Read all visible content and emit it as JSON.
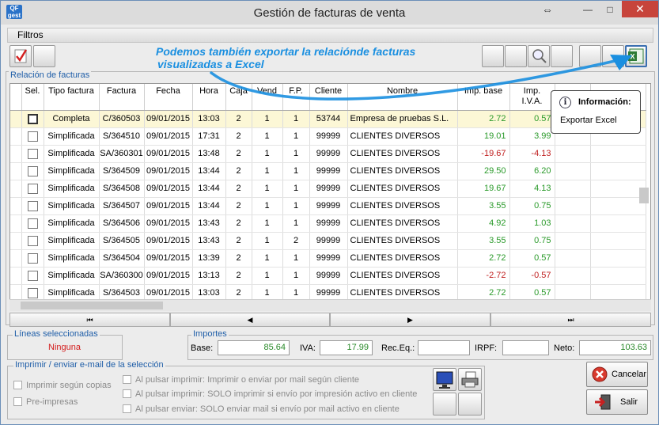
{
  "window": {
    "title": "Gestión de facturas de venta",
    "app_icon_text": "QF\ngest",
    "restore_glyph": "⇔",
    "min_glyph": "—",
    "max_glyph": "□",
    "close_glyph": "✕"
  },
  "filters_bar": {
    "label": "Filtros"
  },
  "callout": {
    "line1": "Podemos también exportar la relaciónde facturas",
    "line2": "visualizadas a Excel"
  },
  "grid_group": {
    "label": "Relación de facturas"
  },
  "grid": {
    "columns": [
      {
        "label": "Sel."
      },
      {
        "label": "Tipo factura"
      },
      {
        "label": "Factura"
      },
      {
        "label": "Fecha"
      },
      {
        "label": "Hora"
      },
      {
        "label": "Caja"
      },
      {
        "label": "Vend"
      },
      {
        "label": "F.P."
      },
      {
        "label": "Cliente"
      },
      {
        "label": "Nombre"
      },
      {
        "label": "Imp. base"
      },
      {
        "label": "Imp. I.V.A."
      },
      {
        "label": ""
      },
      {
        "label": ""
      }
    ],
    "rows": [
      {
        "tipo": "Completa",
        "factura": "C/360503",
        "fecha": "09/01/2015",
        "hora": "13:03",
        "caja": "2",
        "vend": "1",
        "fp": "1",
        "cliente": "53744",
        "nombre": "Empresa de pruebas S.L.",
        "base": "2.72",
        "iva": "0.57",
        "selected": true
      },
      {
        "tipo": "Simplificada",
        "factura": "S/364510",
        "fecha": "09/01/2015",
        "hora": "17:31",
        "caja": "2",
        "vend": "1",
        "fp": "1",
        "cliente": "99999",
        "nombre": "CLIENTES DIVERSOS",
        "base": "19.01",
        "iva": "3.99",
        "selected": false
      },
      {
        "tipo": "Simplificada",
        "factura": "SA/360301",
        "fecha": "09/01/2015",
        "hora": "13:48",
        "caja": "2",
        "vend": "1",
        "fp": "1",
        "cliente": "99999",
        "nombre": "CLIENTES DIVERSOS",
        "base": "-19.67",
        "iva": "-4.13",
        "selected": false
      },
      {
        "tipo": "Simplificada",
        "factura": "S/364509",
        "fecha": "09/01/2015",
        "hora": "13:44",
        "caja": "2",
        "vend": "1",
        "fp": "1",
        "cliente": "99999",
        "nombre": "CLIENTES DIVERSOS",
        "base": "29.50",
        "iva": "6.20",
        "selected": false
      },
      {
        "tipo": "Simplificada",
        "factura": "S/364508",
        "fecha": "09/01/2015",
        "hora": "13:44",
        "caja": "2",
        "vend": "1",
        "fp": "1",
        "cliente": "99999",
        "nombre": "CLIENTES DIVERSOS",
        "base": "19.67",
        "iva": "4.13",
        "selected": false
      },
      {
        "tipo": "Simplificada",
        "factura": "S/364507",
        "fecha": "09/01/2015",
        "hora": "13:44",
        "caja": "2",
        "vend": "1",
        "fp": "1",
        "cliente": "99999",
        "nombre": "CLIENTES DIVERSOS",
        "base": "3.55",
        "iva": "0.75",
        "selected": false
      },
      {
        "tipo": "Simplificada",
        "factura": "S/364506",
        "fecha": "09/01/2015",
        "hora": "13:43",
        "caja": "2",
        "vend": "1",
        "fp": "1",
        "cliente": "99999",
        "nombre": "CLIENTES DIVERSOS",
        "base": "4.92",
        "iva": "1.03",
        "selected": false
      },
      {
        "tipo": "Simplificada",
        "factura": "S/364505",
        "fecha": "09/01/2015",
        "hora": "13:43",
        "caja": "2",
        "vend": "1",
        "fp": "2",
        "cliente": "99999",
        "nombre": "CLIENTES DIVERSOS",
        "base": "3.55",
        "iva": "0.75",
        "selected": false
      },
      {
        "tipo": "Simplificada",
        "factura": "S/364504",
        "fecha": "09/01/2015",
        "hora": "13:39",
        "caja": "2",
        "vend": "1",
        "fp": "1",
        "cliente": "99999",
        "nombre": "CLIENTES DIVERSOS",
        "base": "2.72",
        "iva": "0.57",
        "selected": false
      },
      {
        "tipo": "Simplificada",
        "factura": "SA/360300",
        "fecha": "09/01/2015",
        "hora": "13:13",
        "caja": "2",
        "vend": "1",
        "fp": "1",
        "cliente": "99999",
        "nombre": "CLIENTES DIVERSOS",
        "base": "-2.72",
        "iva": "-0.57",
        "selected": false
      },
      {
        "tipo": "Simplificada",
        "factura": "S/364503",
        "fecha": "09/01/2015",
        "hora": "13:03",
        "caja": "2",
        "vend": "1",
        "fp": "1",
        "cliente": "99999",
        "nombre": "CLIENTES DIVERSOS",
        "base": "2.72",
        "iva": "0.57",
        "selected": false
      }
    ]
  },
  "nav": {
    "first": "⏮",
    "prev": "◀",
    "next": "▶",
    "last": "⏭"
  },
  "tooltip": {
    "icon": "i",
    "title": "Información:",
    "text": "Exportar Excel"
  },
  "selected_lines": {
    "label": "Líneas seleccionadas",
    "value": "Ninguna"
  },
  "totals": {
    "label": "Importes",
    "base_label": "Base:",
    "base": "85.64",
    "iva_label": "IVA:",
    "iva": "17.99",
    "receq_label": "Rec.Eq.:",
    "receq": "",
    "irpf_label": "IRPF:",
    "irpf": "",
    "neto_label": "Neto:",
    "neto": "103.63"
  },
  "print": {
    "label": "Imprimir / enviar e-mail de la selección",
    "opt_copies": "Imprimir según copias",
    "opt_preprinted": "Pre-impresas",
    "opt_mail_client": "Al pulsar imprimir: Imprimir o enviar por mail según cliente",
    "opt_only_print": "Al pulsar imprimir: SOLO imprimir si envío por impresión activo en cliente",
    "opt_only_mail": "Al pulsar enviar: SOLO enviar mail si envío por mail activo en cliente"
  },
  "buttons": {
    "cancel": "Cancelar",
    "exit": "Salir"
  },
  "colors": {
    "positive": "#2a9a2a",
    "negative": "#c02020",
    "callout": "#1a8fe0",
    "close": "#c7443b"
  }
}
